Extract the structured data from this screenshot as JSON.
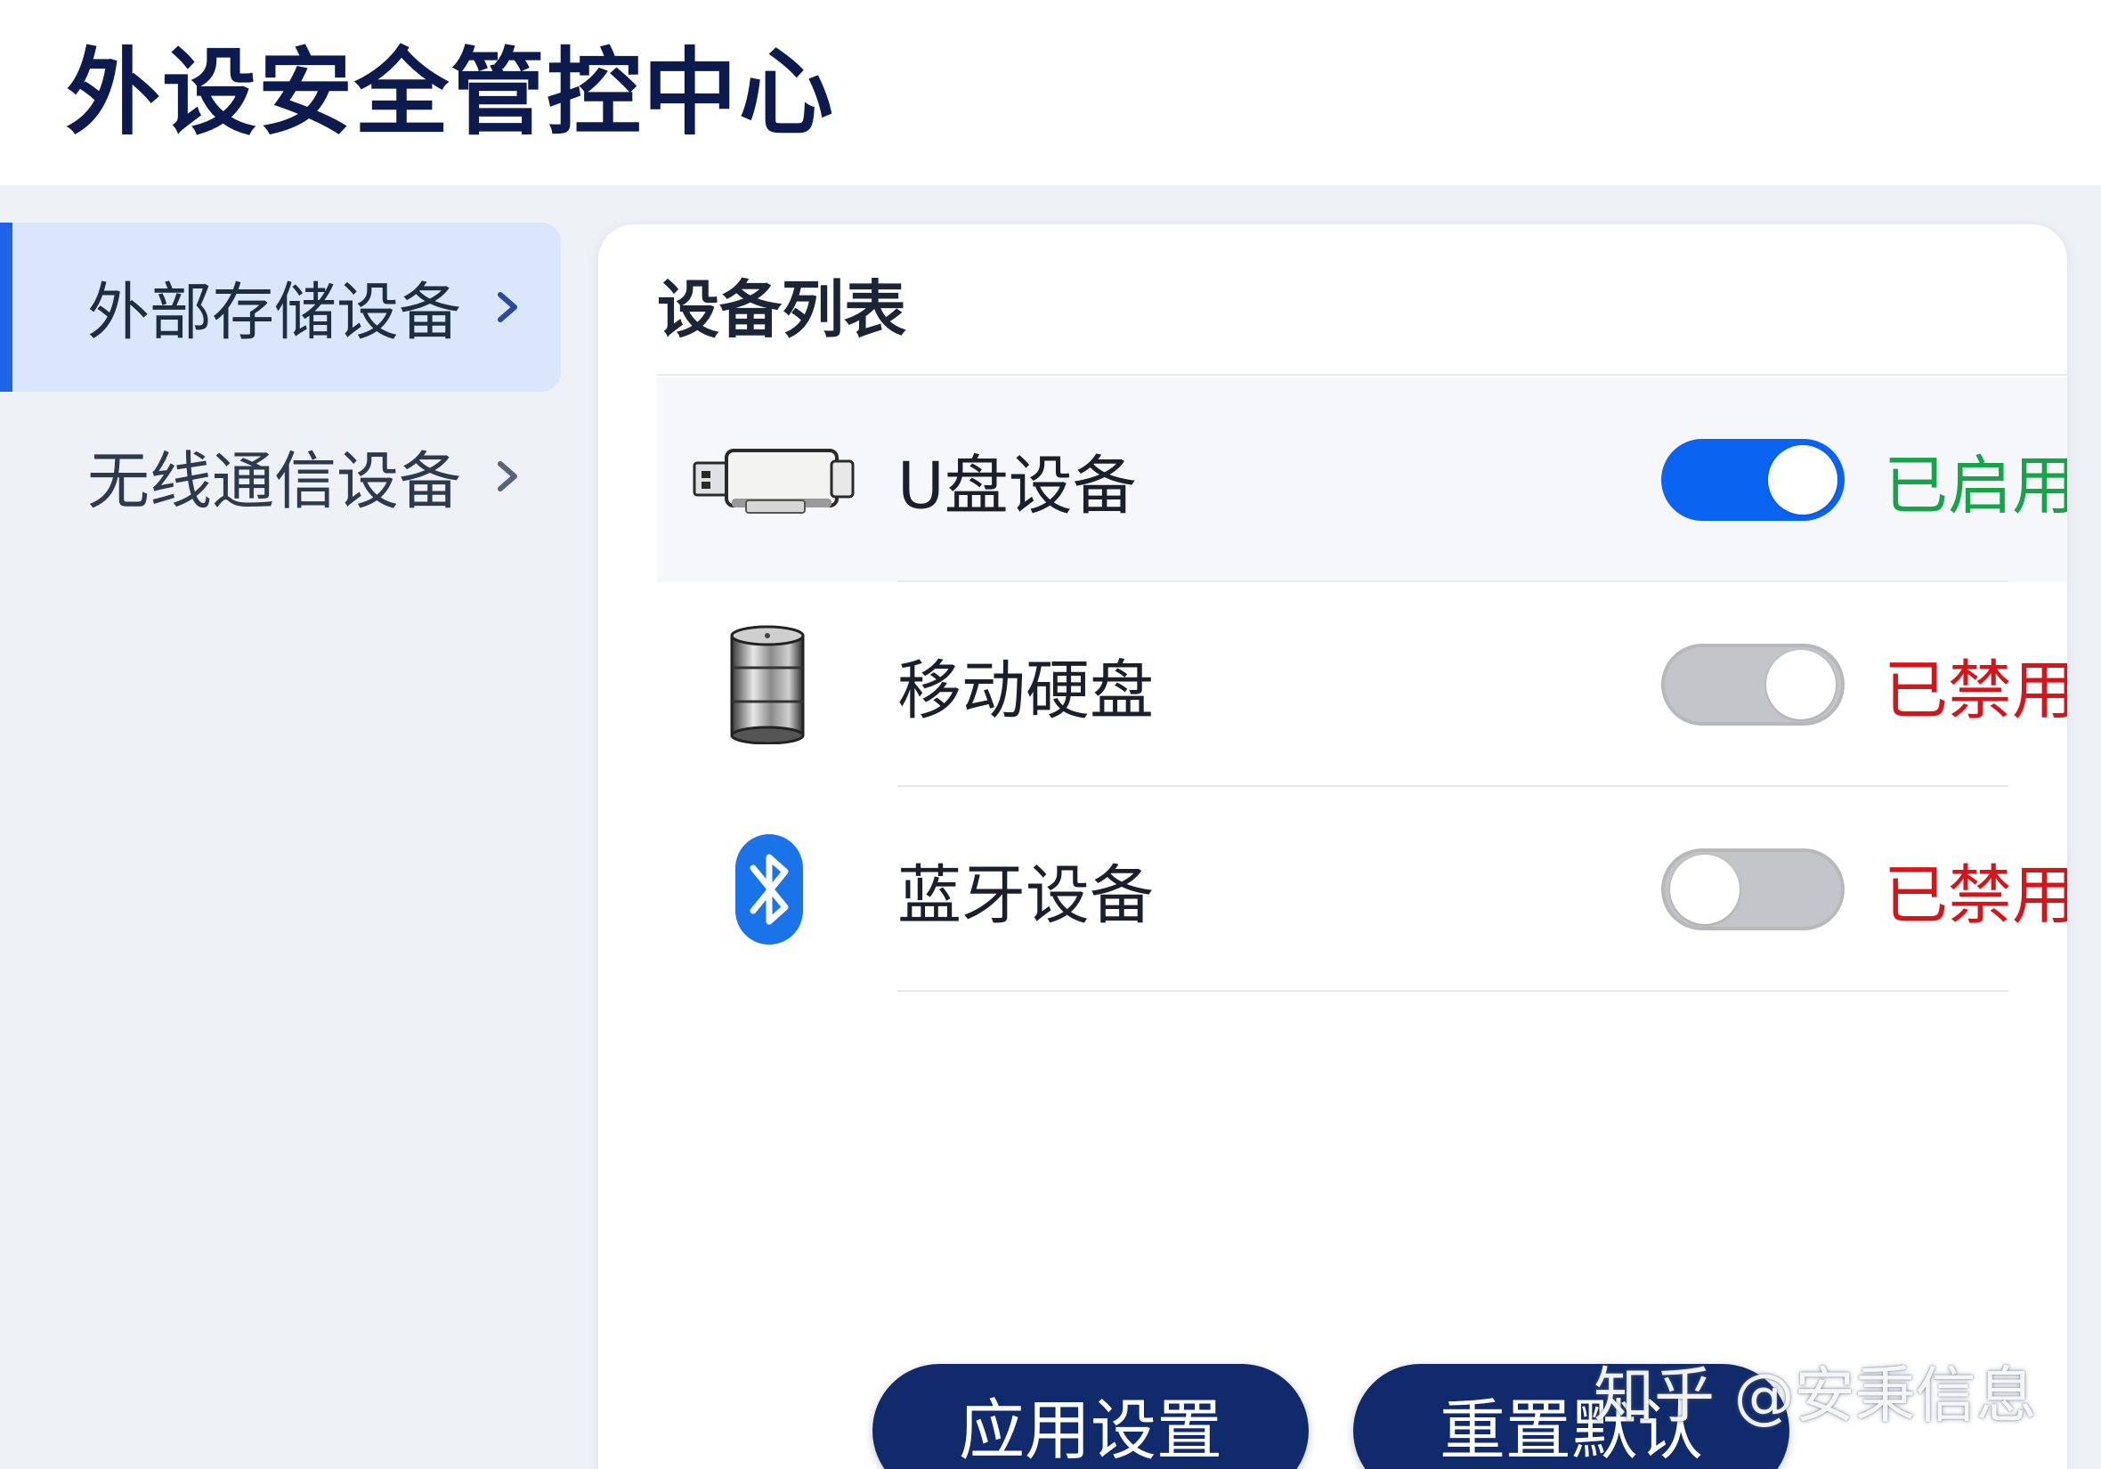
{
  "header": {
    "title": "外设安全管控中心"
  },
  "sidebar": {
    "items": [
      {
        "label": "外部存储设备",
        "active": true
      },
      {
        "label": "无线通信设备",
        "active": false
      }
    ]
  },
  "main": {
    "panel_title": "设备列表",
    "devices": [
      {
        "name": "U盘设备",
        "icon": "usb-drive-icon",
        "enabled": true,
        "status": "已启用"
      },
      {
        "name": "移动硬盘",
        "icon": "hard-disk-icon",
        "enabled": false,
        "status": "已禁用"
      },
      {
        "name": "蓝牙设备",
        "icon": "bluetooth-icon",
        "enabled": false,
        "status": "已禁用"
      }
    ]
  },
  "actions": {
    "apply_label": "应用设置",
    "reset_label": "重置默认"
  },
  "watermark": {
    "text": "知乎 @安秉信息"
  },
  "colors": {
    "accent": "#0b63f2",
    "title": "#0d1a4d",
    "button": "#102a6b",
    "enabled": "#17a348",
    "disabled": "#d4161b",
    "active_nav_bg": "#d9e6fb"
  }
}
